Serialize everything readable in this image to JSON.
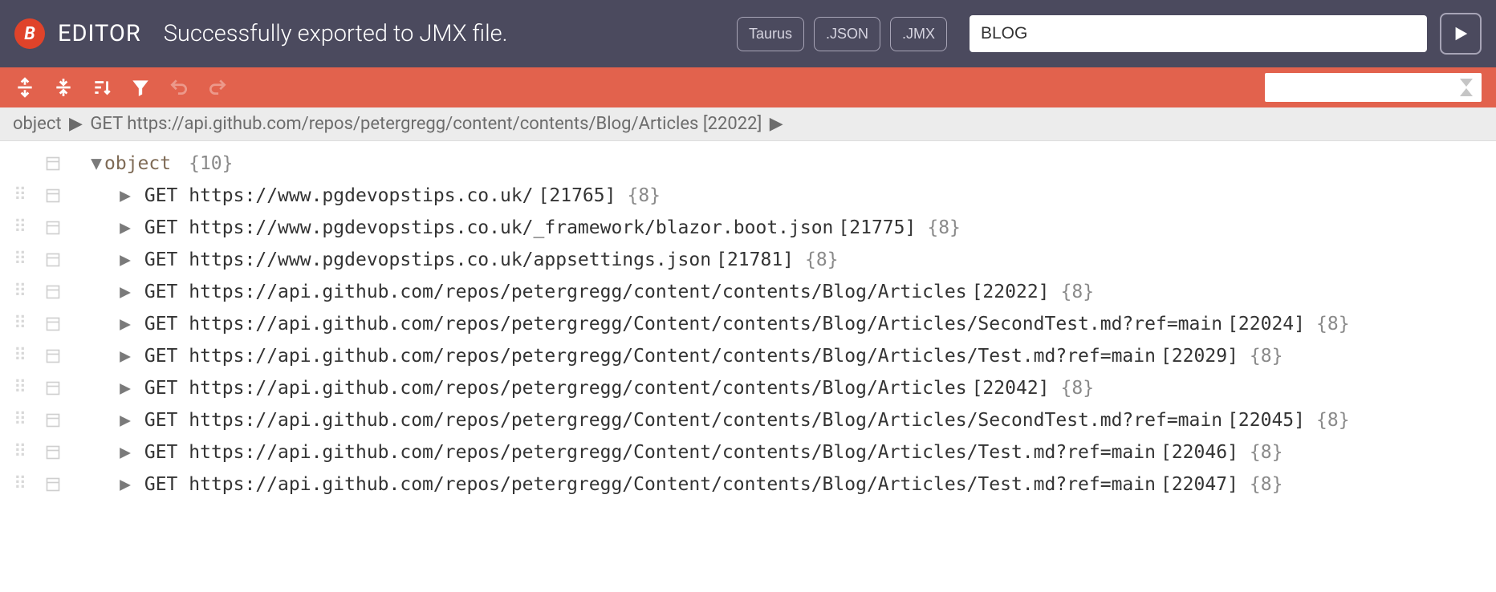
{
  "header": {
    "app_title": "EDITOR",
    "status": "Successfully exported to JMX file.",
    "export_buttons": [
      "Taurus",
      ".JSON",
      ".JMX"
    ],
    "test_name": "BLOG"
  },
  "toolbar": {
    "search_value": ""
  },
  "breadcrumb": {
    "root": "object",
    "path": "GET https://api.github.com/repos/petergregg/content/contents/Blog/Articles [22022]"
  },
  "tree": {
    "root_label": "object",
    "root_count": "{10}",
    "rows": [
      {
        "method": "GET",
        "url": "https://www.pgdevopstips.co.uk/",
        "id": "[21765]",
        "count": "{8}"
      },
      {
        "method": "GET",
        "url": "https://www.pgdevopstips.co.uk/_framework/blazor.boot.json",
        "id": "[21775]",
        "count": "{8}"
      },
      {
        "method": "GET",
        "url": "https://www.pgdevopstips.co.uk/appsettings.json",
        "id": "[21781]",
        "count": "{8}"
      },
      {
        "method": "GET",
        "url": "https://api.github.com/repos/petergregg/content/contents/Blog/Articles",
        "id": "[22022]",
        "count": "{8}"
      },
      {
        "method": "GET",
        "url": "https://api.github.com/repos/petergregg/Content/contents/Blog/Articles/SecondTest.md?ref=main",
        "id": "[22024]",
        "count": "{8}"
      },
      {
        "method": "GET",
        "url": "https://api.github.com/repos/petergregg/Content/contents/Blog/Articles/Test.md?ref=main",
        "id": "[22029]",
        "count": "{8}"
      },
      {
        "method": "GET",
        "url": "https://api.github.com/repos/petergregg/content/contents/Blog/Articles",
        "id": "[22042]",
        "count": "{8}"
      },
      {
        "method": "GET",
        "url": "https://api.github.com/repos/petergregg/Content/contents/Blog/Articles/SecondTest.md?ref=main",
        "id": "[22045]",
        "count": "{8}"
      },
      {
        "method": "GET",
        "url": "https://api.github.com/repos/petergregg/Content/contents/Blog/Articles/Test.md?ref=main",
        "id": "[22046]",
        "count": "{8}"
      },
      {
        "method": "GET",
        "url": "https://api.github.com/repos/petergregg/Content/contents/Blog/Articles/Test.md?ref=main",
        "id": "[22047]",
        "count": "{8}"
      }
    ]
  }
}
